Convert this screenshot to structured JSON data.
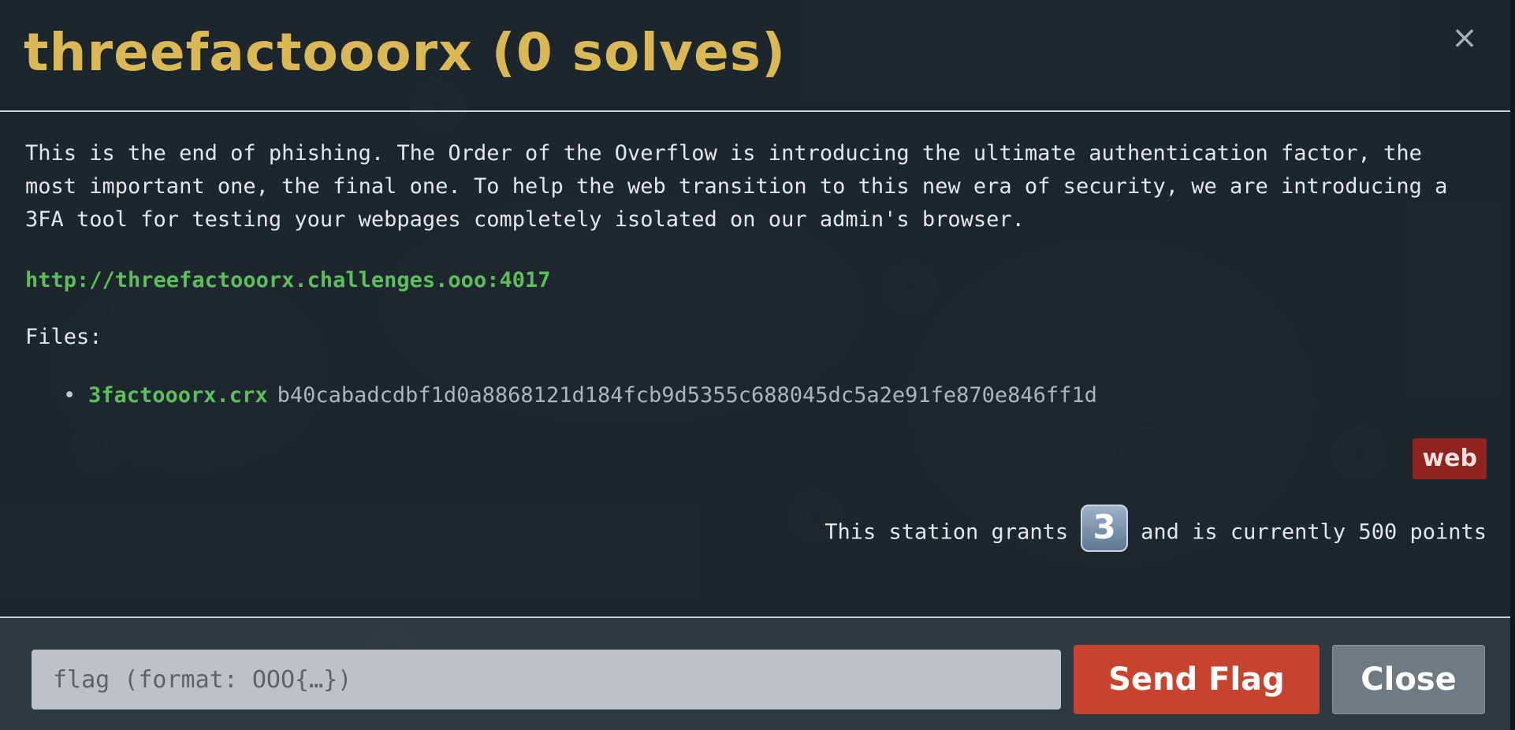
{
  "modal": {
    "title": "threefactooorx (0 solves)",
    "close_icon": "×"
  },
  "challenge": {
    "description": "This is the end of phishing. The Order of the Overflow is introducing the ultimate authentication factor, the most important one, the final one. To help the web transition to this new era of security, we are introducing a 3FA tool for testing your webpages completely isolated on our admin's browser.",
    "url": "http://threefactooorx.challenges.ooo:4017",
    "files_label": "Files:",
    "files": [
      {
        "name": "3factooorx.crx",
        "hash": "b40cabadcdbf1d0a8868121d184fcb9d5355c688045dc5a2e91fe870e846ff1d"
      }
    ],
    "category_tag": "web",
    "grants_prefix": "This station grants",
    "grants_value": "3",
    "grants_suffix": "and is currently 500 points"
  },
  "footer": {
    "flag_placeholder": "flag (format: OOO{…})",
    "send_label": "Send Flag",
    "close_label": "Close"
  },
  "colors": {
    "title": "#d9b855",
    "link": "#5cbf5c",
    "send_button": "#c7432e",
    "close_button": "#707a82",
    "tag": "#8f2320"
  }
}
